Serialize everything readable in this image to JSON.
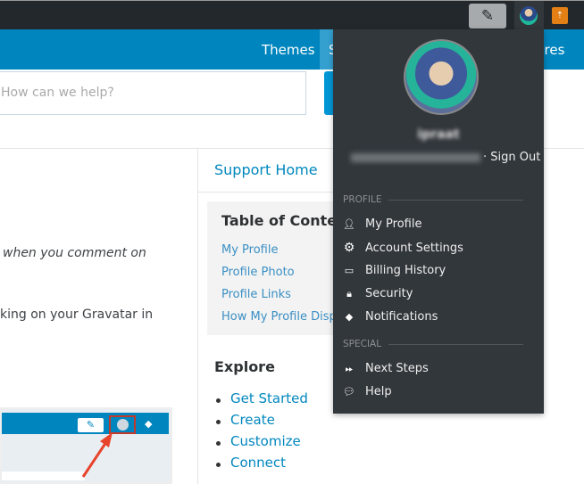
{
  "topbar": {
    "write_icon": "write-post-icon",
    "me_icon": "avatar",
    "notifications_icon": "notifications-icon"
  },
  "nav": {
    "items": [
      "Themes",
      "S",
      "ures"
    ]
  },
  "search": {
    "placeholder": "How can we help?"
  },
  "article": {
    "line1": "when you comment on",
    "line2": "king on your Gravatar in"
  },
  "sidebar": {
    "support_home": "Support Home",
    "toc_title": "Table of Contents",
    "toc_items": [
      "My Profile",
      "Profile Photo",
      "Profile Links",
      "How My Profile Displays"
    ],
    "explore_title": "Explore",
    "explore_items": [
      "Get Started",
      "Create",
      "Customize",
      "Connect"
    ]
  },
  "dropdown": {
    "username": "ipraat",
    "sign_out": "· Sign Out",
    "profile_label": "PROFILE",
    "profile_items": [
      {
        "label": "My Profile",
        "icon": "user-icon"
      },
      {
        "label": "Account Settings",
        "icon": "gear-icon"
      },
      {
        "label": "Billing History",
        "icon": "money-icon"
      },
      {
        "label": "Security",
        "icon": "lock-icon"
      },
      {
        "label": "Notifications",
        "icon": "bell-icon"
      }
    ],
    "special_label": "SPECIAL",
    "special_items": [
      {
        "label": "Next Steps",
        "icon": "fast-forward-icon"
      },
      {
        "label": "Help",
        "icon": "chat-bubbles-icon"
      }
    ]
  }
}
